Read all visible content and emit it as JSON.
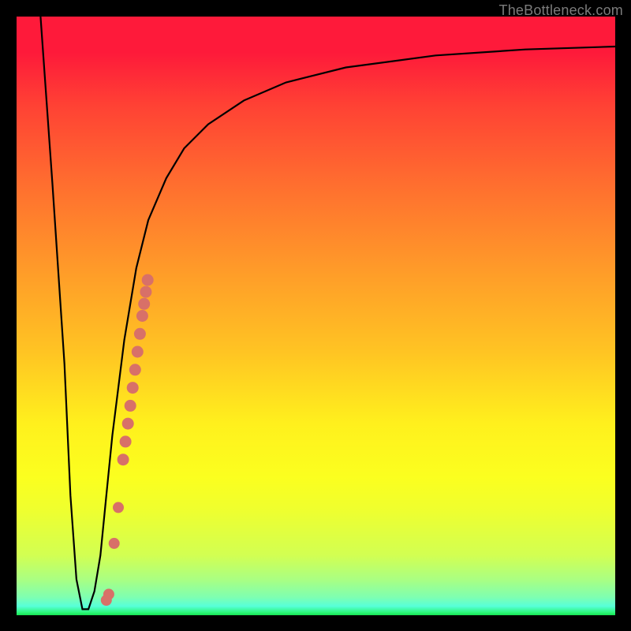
{
  "attribution": "TheBottleneck.com",
  "colors": {
    "background": "#000000",
    "curve": "#000000",
    "marker": "#d87068",
    "gradient_top": "#fe1a3a",
    "gradient_bottom": "#14e452"
  },
  "chart_data": {
    "type": "line",
    "title": "",
    "xlabel": "",
    "ylabel": "",
    "xlim": [
      0,
      100
    ],
    "ylim": [
      0,
      100
    ],
    "curve": {
      "x": [
        4,
        6,
        8,
        9,
        10,
        11,
        12,
        13,
        14,
        15,
        16,
        18,
        20,
        22,
        25,
        28,
        32,
        38,
        45,
        55,
        70,
        85,
        100
      ],
      "y": [
        100,
        72,
        42,
        20,
        6,
        1,
        1,
        4,
        10,
        20,
        30,
        46,
        58,
        66,
        73,
        78,
        82,
        86,
        89,
        91.5,
        93.5,
        94.5,
        95
      ]
    },
    "markers": [
      {
        "x": 15.0,
        "y": 2.5
      },
      {
        "x": 15.4,
        "y": 3.5
      },
      {
        "x": 16.3,
        "y": 12
      },
      {
        "x": 17.0,
        "y": 18
      },
      {
        "x": 17.8,
        "y": 26
      },
      {
        "x": 18.2,
        "y": 29
      },
      {
        "x": 18.6,
        "y": 32
      },
      {
        "x": 19.0,
        "y": 35
      },
      {
        "x": 19.4,
        "y": 38
      },
      {
        "x": 19.8,
        "y": 41
      },
      {
        "x": 20.2,
        "y": 44
      },
      {
        "x": 20.6,
        "y": 47
      },
      {
        "x": 21.0,
        "y": 50
      },
      {
        "x": 21.3,
        "y": 52
      },
      {
        "x": 21.6,
        "y": 54
      },
      {
        "x": 21.9,
        "y": 56
      }
    ]
  }
}
